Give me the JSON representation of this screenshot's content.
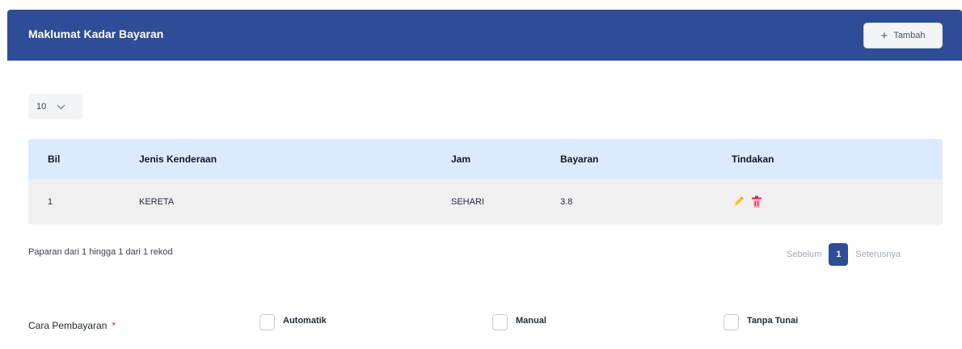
{
  "header": {
    "title": "Maklumat Kadar Bayaran",
    "add_button_label": "Tambah",
    "add_button_icon": "plus-icon"
  },
  "page_size": {
    "selected": "10",
    "icon": "chevron-down-icon"
  },
  "table": {
    "columns": [
      "Bil",
      "Jenis Kenderaan",
      "Jam",
      "Bayaran",
      "Tindakan"
    ],
    "rows": [
      {
        "bil": "1",
        "jenis_kenderaan": "KERETA",
        "jam": "SEHARI",
        "bayaran": "3.8",
        "actions": [
          "pencil-icon",
          "trash-icon"
        ]
      }
    ]
  },
  "info_text": "Paparan dari 1 hingga 1 dari 1 rekod",
  "pagination": {
    "prev_label": "Sebelum",
    "current_page": "1",
    "next_label": "Seterusnya"
  },
  "payment": {
    "label": "Cara Pembayaran",
    "required_mark": "*",
    "options": [
      "Automatik",
      "Manual",
      "Tanpa Tunai"
    ]
  },
  "colors": {
    "header_bg": "#2e4d96",
    "table_header_bg": "#dbeafe",
    "row_bg": "#f0f0f1",
    "edit_icon": "#f5c518",
    "delete_icon": "#e11d48",
    "required": "#dc2626"
  }
}
